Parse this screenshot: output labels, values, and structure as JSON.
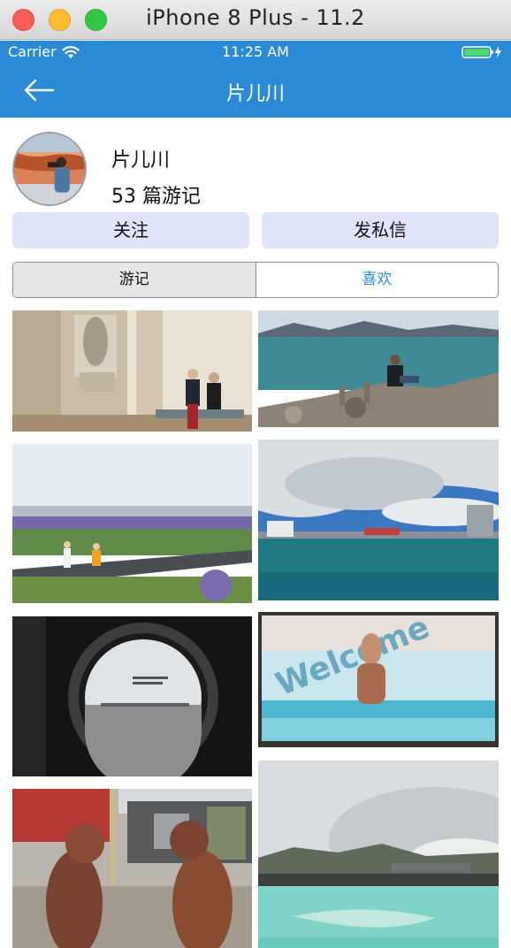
{
  "window": {
    "title": "iPhone 8 Plus - 11.2"
  },
  "status_bar": {
    "carrier": "Carrier",
    "time": "11:25 AM"
  },
  "nav": {
    "title": "片儿川"
  },
  "profile": {
    "name": "片儿川",
    "count_text": "53 篇游记"
  },
  "actions": {
    "follow_label": "关注",
    "message_label": "发私信"
  },
  "segments": [
    {
      "label": "游记",
      "selected": false
    },
    {
      "label": "喜欢",
      "selected": true
    }
  ],
  "photos": [
    {
      "subject": "couple seated on a bench beside a statue in a stone archway"
    },
    {
      "subject": "man sitting on rocks by the sea with distant mountains"
    },
    {
      "subject": "children walking along a path through lupin fields"
    },
    {
      "subject": "harbour with moored ships under a cloudy sky"
    },
    {
      "subject": "view of an airport through a round porthole window"
    },
    {
      "subject": "Welcome billboard with a smiling person in blue water"
    },
    {
      "subject": "two rusty sculptures of figures facing each other on a street"
    },
    {
      "subject": "milky blue lagoon with steam rising from a plant"
    }
  ],
  "colors": {
    "accent": "#2b8ad6",
    "button_bg": "#dfe4fb"
  }
}
